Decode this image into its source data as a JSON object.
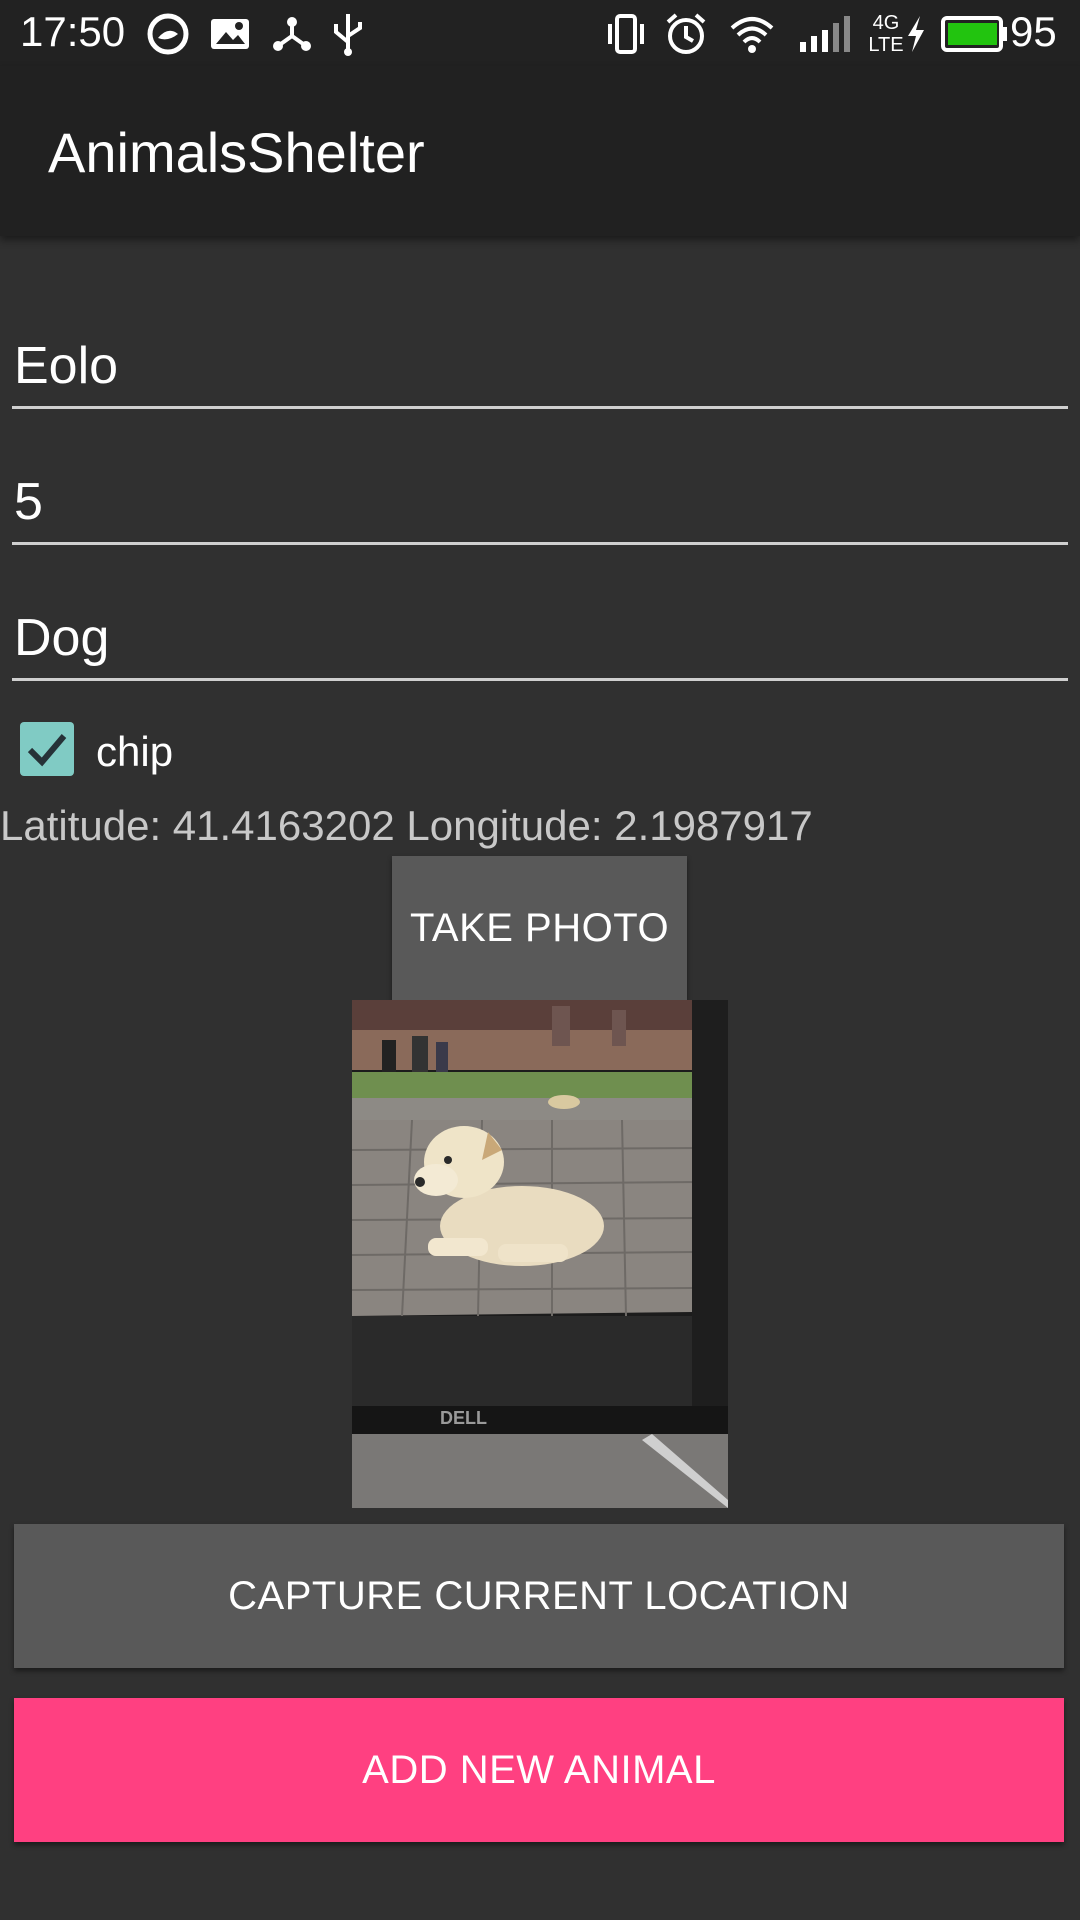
{
  "status_bar": {
    "time": "17:50",
    "battery_percent": "95",
    "network_label": "4G",
    "network_sub": "LTE",
    "icons": [
      "messenger-icon",
      "gallery-icon",
      "share-icon",
      "usb-icon",
      "vibrate-icon",
      "alarm-icon",
      "wifi-icon",
      "signal-icon",
      "charging-icon",
      "battery-icon"
    ],
    "battery_color": "#22c40f"
  },
  "app_bar": {
    "title": "AnimalsShelter"
  },
  "form": {
    "name_value": "Eolo",
    "age_value": "5",
    "species_value": "Dog",
    "chip_label": "chip",
    "chip_checked": true
  },
  "location_text": "Latitude: 41.4163202 Longitude: 2.1987917",
  "buttons": {
    "take_photo": "TAKE PHOTO",
    "capture_location": "CAPTURE CURRENT LOCATION",
    "add_animal": "ADD NEW ANIMAL"
  },
  "photo": {
    "monitor_brand": "DELL"
  },
  "colors": {
    "accent": "#ff4081",
    "checkbox": "#80cbc4",
    "background": "#303030",
    "toolbar": "#212121"
  }
}
